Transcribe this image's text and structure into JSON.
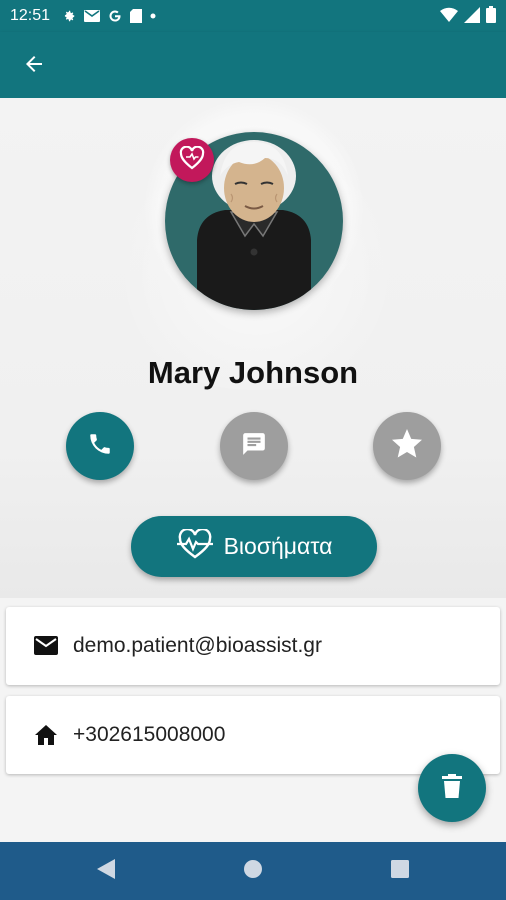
{
  "status_bar": {
    "time": "12:51",
    "icons": [
      "gear-icon",
      "mail-icon",
      "google-icon",
      "sd-card-icon",
      "dot-icon"
    ],
    "right_icons": [
      "wifi-icon",
      "signal-icon",
      "battery-icon"
    ]
  },
  "app_bar": {
    "back_icon": "arrow-back-icon"
  },
  "profile": {
    "name": "Mary Johnson",
    "badge_icon": "heart-icon"
  },
  "actions": {
    "call_icon": "phone-icon",
    "message_icon": "message-icon",
    "favorite_icon": "star-icon"
  },
  "vitals_button": {
    "label": "Βιοσήματα",
    "icon": "heart-pulse-icon"
  },
  "contact": {
    "email": "demo.patient@bioassist.gr",
    "phone": "+302615008000"
  },
  "fab": {
    "icon": "trash-icon"
  },
  "colors": {
    "primary": "#12757e",
    "badge": "#c2185b",
    "inactive": "#9e9e9e",
    "nav_bar": "#1f5b8a"
  }
}
